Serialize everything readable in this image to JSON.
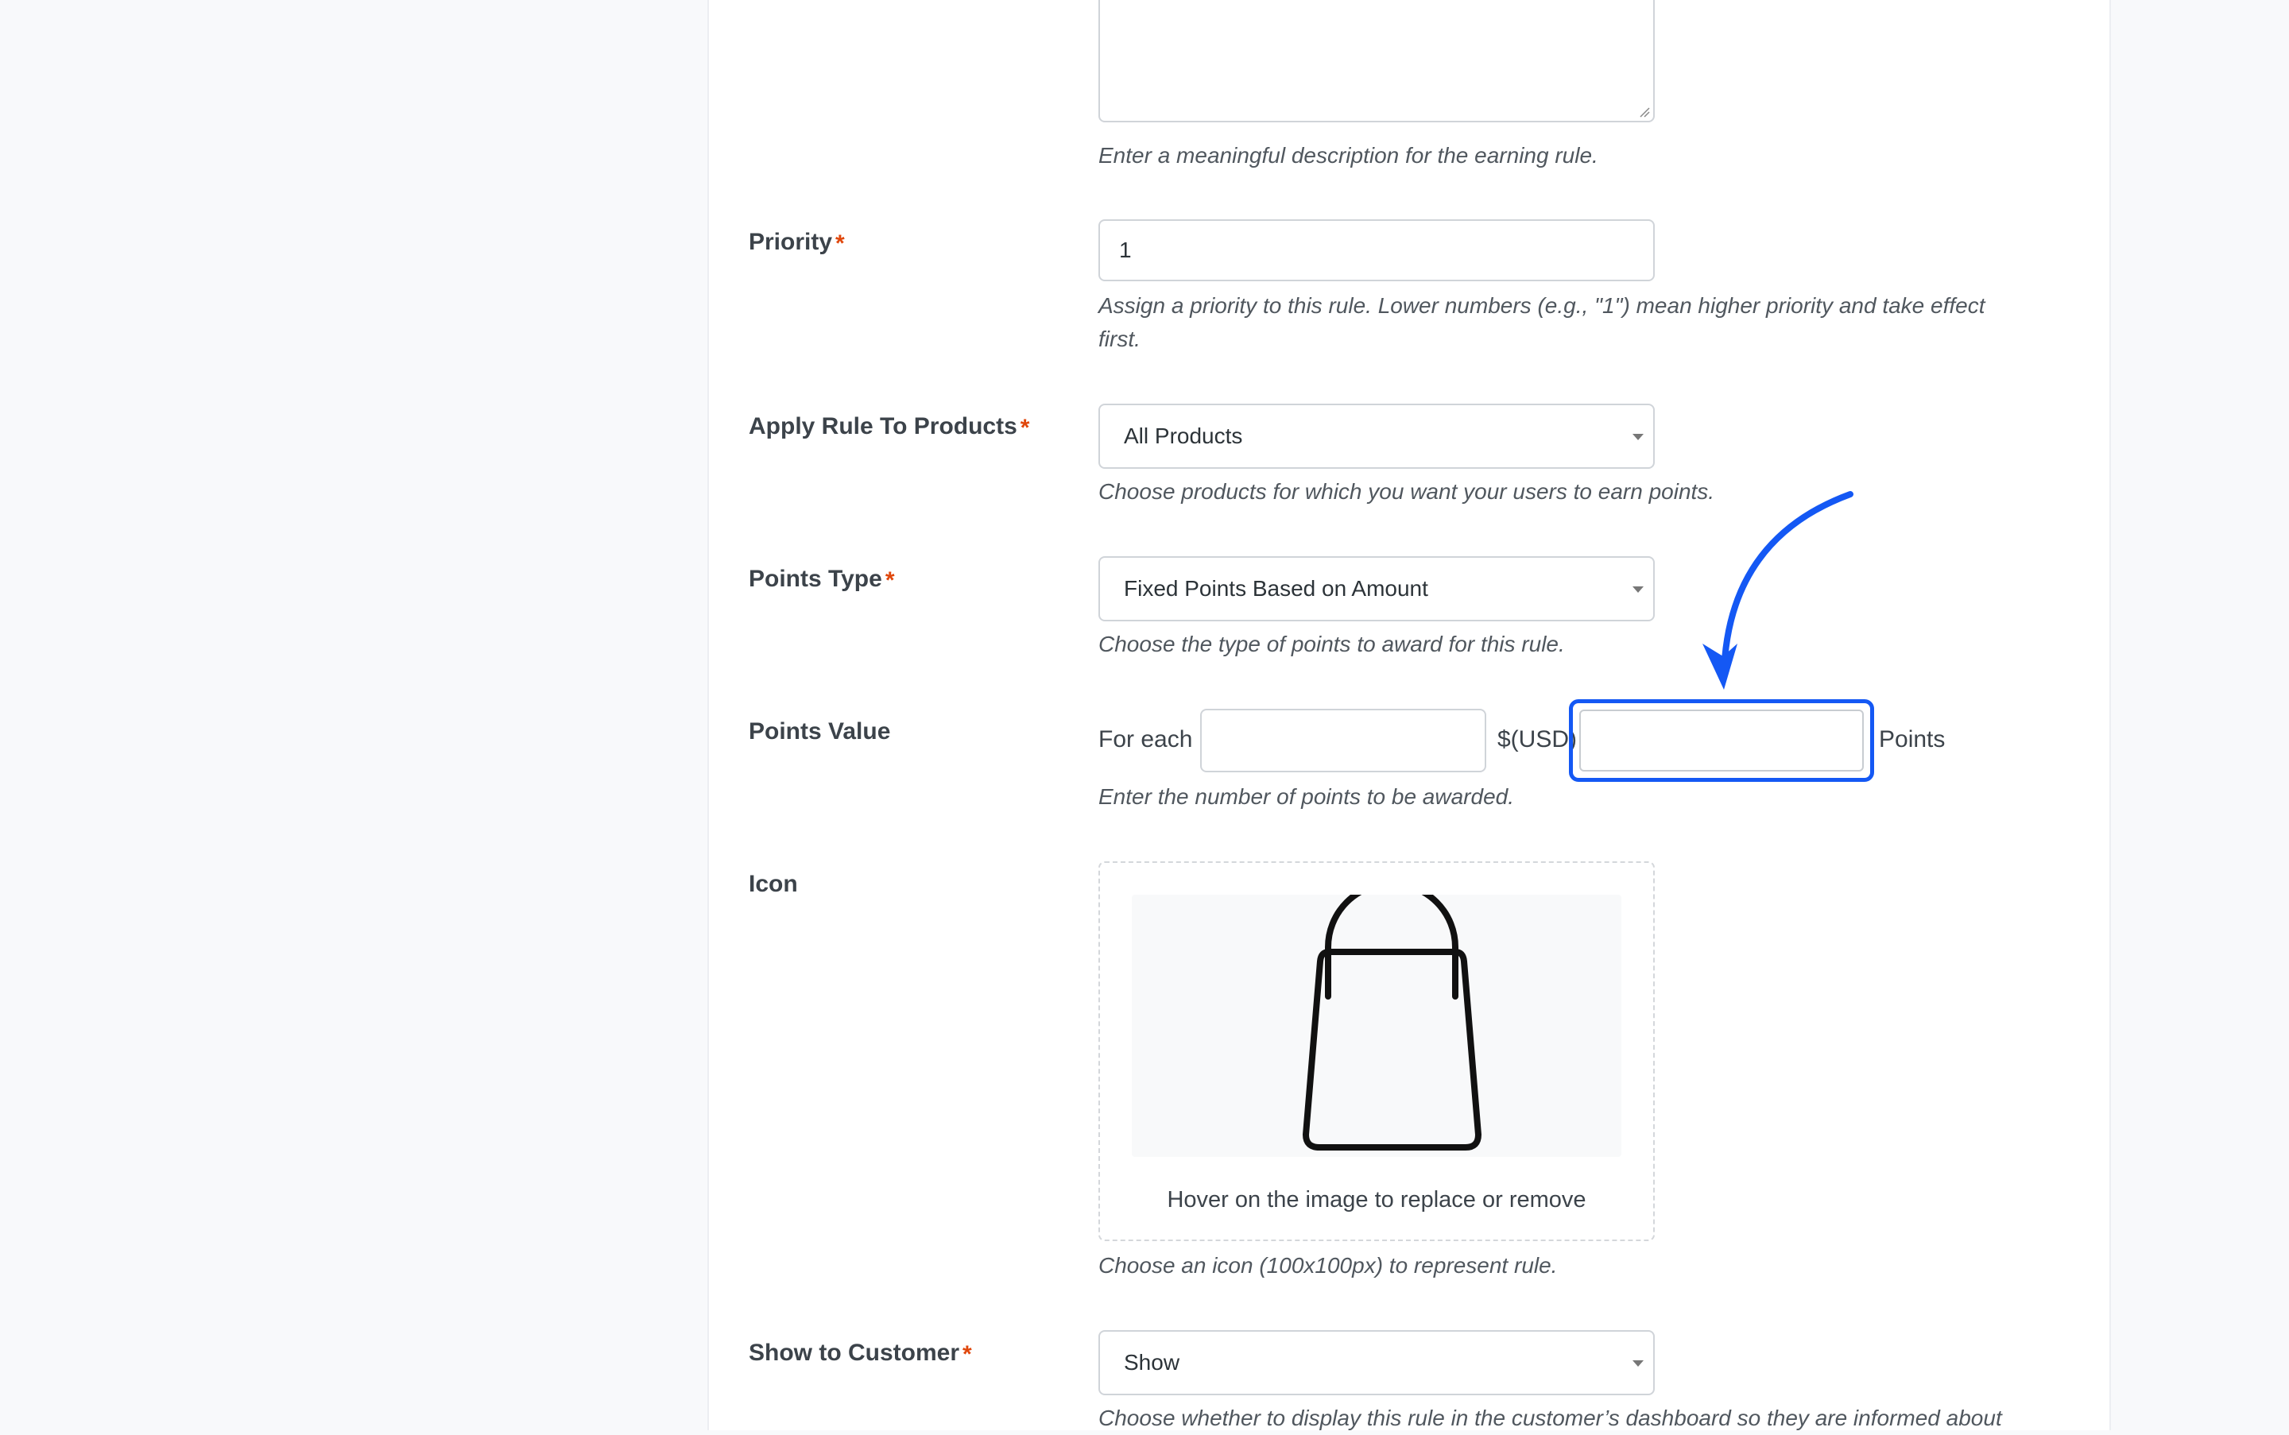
{
  "form": {
    "description": {
      "hint": "Enter a meaningful description for the earning rule."
    },
    "priority": {
      "label": "Priority",
      "required_mark": "*",
      "value": "1",
      "hint_line1": "Assign a priority to this rule. Lower numbers (e.g., \"1\") mean higher priority and take effect",
      "hint_line2": "first."
    },
    "apply_rule": {
      "label": "Apply Rule To Products",
      "required_mark": "*",
      "selected": "All Products",
      "hint": "Choose products for which you want your users to earn points."
    },
    "points_type": {
      "label": "Points Type",
      "required_mark": "*",
      "selected": "Fixed Points Based on Amount",
      "hint": "Choose the type of points to award for this rule."
    },
    "points_value": {
      "label": "Points Value",
      "prefix": "For each",
      "currency": "$(USD)",
      "suffix": "Points",
      "amount_value": "",
      "points_value": "",
      "hint": "Enter the number of points to be awarded."
    },
    "icon": {
      "label": "Icon",
      "icon_name": "shopping-bag-icon",
      "hover_text": "Hover on the image to replace or remove",
      "hint": "Choose an icon (100x100px) to represent rule."
    },
    "show_to_customer": {
      "label": "Show to Customer",
      "required_mark": "*",
      "selected": "Show",
      "hint": "Choose whether to display this rule in the customer’s dashboard so they are informed about"
    }
  },
  "colors": {
    "required": "#e0470c",
    "highlight": "#1458f4",
    "page_background": "#f8f9fb"
  }
}
